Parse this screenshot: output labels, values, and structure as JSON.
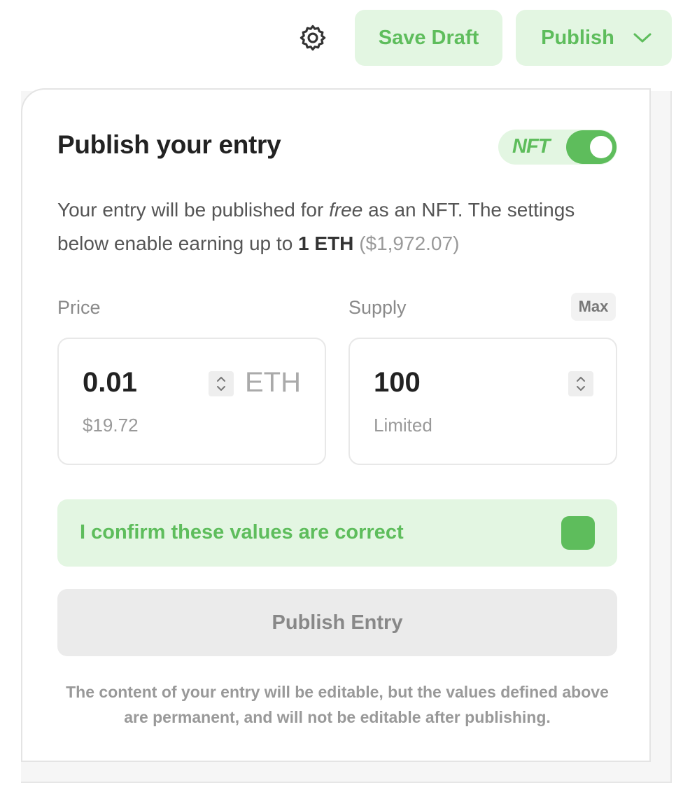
{
  "topbar": {
    "settings_icon": "gear-icon",
    "save_draft_label": "Save Draft",
    "publish_label": "Publish",
    "publish_dropdown_icon": "chevron-down-icon"
  },
  "card": {
    "title": "Publish your entry",
    "nft_toggle": {
      "label": "NFT",
      "on": true
    },
    "description": {
      "part1": "Your entry will be published for ",
      "free": "free",
      "part2": " as an NFT. The settings below enable earning up to ",
      "amount": "1 ETH",
      "amount_usd": "($1,972.07)"
    },
    "price": {
      "label": "Price",
      "value": "0.01",
      "unit": "ETH",
      "usd": "$19.72"
    },
    "supply": {
      "label": "Supply",
      "max_label": "Max",
      "value": "100",
      "sub": "Limited"
    },
    "confirm": {
      "label": "I confirm these values are correct",
      "checked": true
    },
    "publish_entry_label": "Publish Entry",
    "footnote": "The content of your entry will be editable, but the values defined above are permanent, and will not be editable after publishing."
  },
  "colors": {
    "accent": "#5ebd5c",
    "accent_bg": "#e3f6e2",
    "disabled_bg": "#ebebeb"
  }
}
